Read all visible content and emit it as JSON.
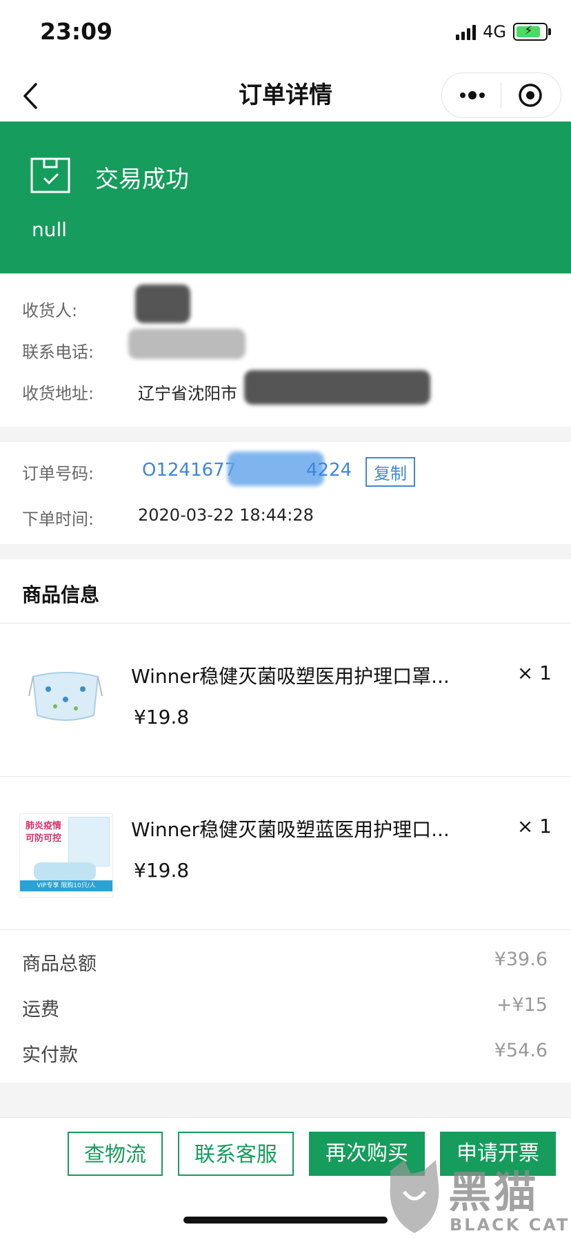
{
  "status_bar": {
    "time": "23:09",
    "network": "4G"
  },
  "nav": {
    "title": "订单详情"
  },
  "banner": {
    "status": "交易成功",
    "subtitle": "null"
  },
  "address": {
    "receiver_label": "收货人:",
    "phone_label": "联系电话:",
    "address_label": "收货地址:",
    "address_value": "辽宁省沈阳市"
  },
  "order": {
    "number_label": "订单号码:",
    "number_prefix": "O1241677",
    "number_suffix": "4224",
    "copy_label": "复制",
    "time_label": "下单时间:",
    "time_value": "2020-03-22 18:44:28"
  },
  "products": {
    "header": "商品信息",
    "items": [
      {
        "name": "Winner稳健灭菌吸塑医用护理口罩...",
        "price": "¥19.8",
        "qty": "× 1"
      },
      {
        "name": "Winner稳健灭菌吸塑蓝医用护理口...",
        "price": "¥19.8",
        "qty": "× 1",
        "thumb_text_1": "肺炎疫情",
        "thumb_text_2": "可防可控",
        "thumb_text_3": "VIP专享 限购10只/人"
      }
    ]
  },
  "summary": {
    "subtotal_label": "商品总额",
    "subtotal": "¥39.6",
    "shipping_label": "运费",
    "shipping": "+¥15",
    "paid_label": "实付款",
    "paid": "¥54.6"
  },
  "actions": {
    "logistics": "查物流",
    "service": "联系客服",
    "rebuy": "再次购买",
    "invoice": "申请开票"
  },
  "watermark": {
    "cn": "黑猫",
    "en": "BLACK CAT"
  },
  "colors": {
    "brand_green": "#169c5c",
    "link_blue": "#3f86d8"
  }
}
